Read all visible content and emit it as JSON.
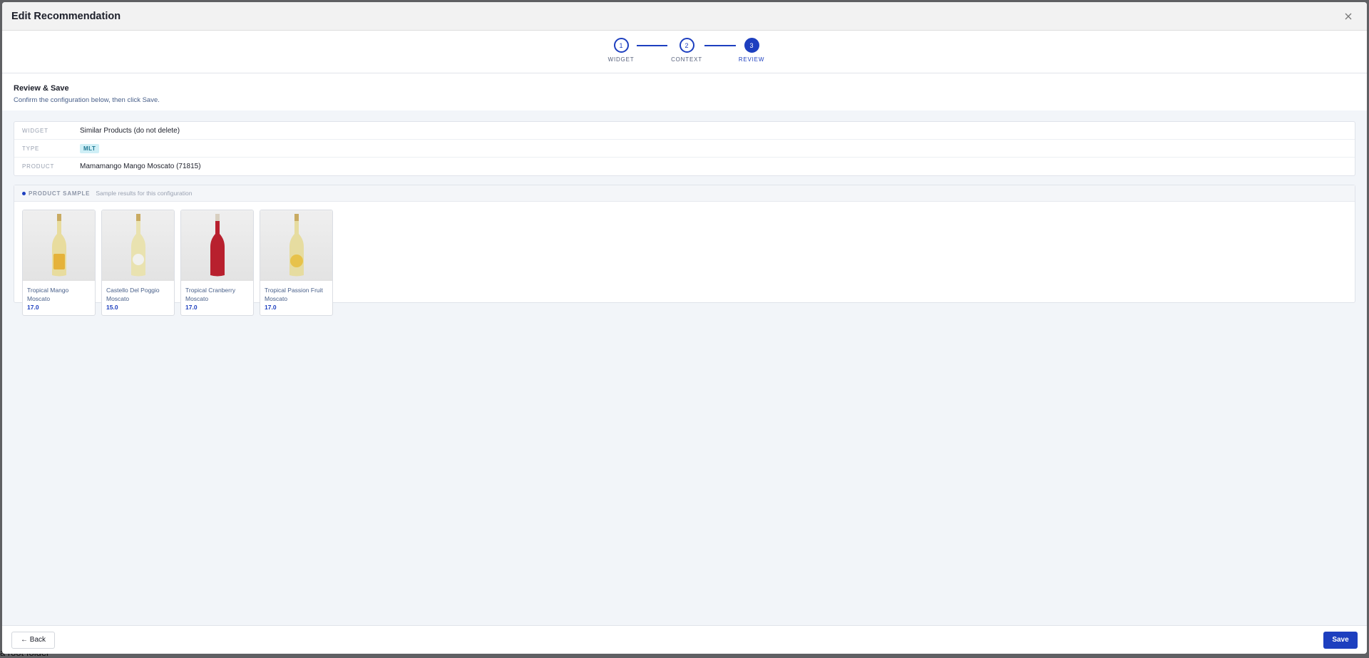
{
  "modal": {
    "title": "Edit Recommendation",
    "close_icon": "close-icon"
  },
  "stepper": {
    "steps": [
      {
        "number": "1",
        "label": "WIDGET"
      },
      {
        "number": "2",
        "label": "CONTEXT"
      },
      {
        "number": "3",
        "label": "REVIEW"
      }
    ],
    "active_step": 3
  },
  "review": {
    "title": "Review & Save",
    "subtitle": "Confirm the configuration below, then click Save."
  },
  "summary": {
    "rows": [
      {
        "key": "WIDGET",
        "value": "Similar Products (do not delete)"
      },
      {
        "key": "TYPE",
        "value": "MLT"
      },
      {
        "key": "PRODUCT",
        "value": "Mamamango Mango Moscato (71815)"
      }
    ]
  },
  "sample": {
    "label": "PRODUCT SAMPLE",
    "subtitle": "Sample results for this configuration",
    "products": [
      {
        "name": "Tropical Mango Moscato",
        "price": "17.0",
        "wine_color": "#e8dc9e",
        "label_color": "#e5b23a"
      },
      {
        "name": "Castello Del Poggio Moscato",
        "price": "15.0",
        "wine_color": "#e9e2b0",
        "label_color": "#f1f1ee"
      },
      {
        "name": "Tropical Cranberry Moscato",
        "price": "17.0",
        "wine_color": "#b8202e",
        "label_color": "#b8202e"
      },
      {
        "name": "Tropical Passion Fruit Moscato",
        "price": "17.0",
        "wine_color": "#e6dca0",
        "label_color": "#e7c24a"
      }
    ]
  },
  "footer": {
    "back_label": "← Back",
    "save_label": "Save"
  },
  "backdrop": {
    "partial_text": "a root folder"
  },
  "colors": {
    "accent": "#1d3fbf",
    "badge_bg": "#cfeff6",
    "badge_text": "#1d7792"
  }
}
